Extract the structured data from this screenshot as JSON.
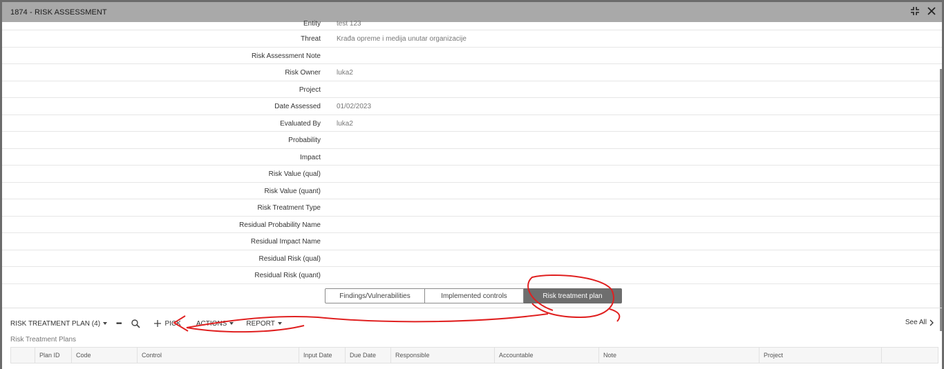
{
  "window": {
    "title": "1874 - RISK ASSESSMENT"
  },
  "fields": [
    {
      "label": "Entity",
      "value": "test 123"
    },
    {
      "label": "Threat",
      "value": "Krađa opreme i medija unutar organizacije"
    },
    {
      "label": "Risk Assessment Note",
      "value": ""
    },
    {
      "label": "Risk Owner",
      "value": "luka2"
    },
    {
      "label": "Project",
      "value": ""
    },
    {
      "label": "Date Assessed",
      "value": "01/02/2023"
    },
    {
      "label": "Evaluated By",
      "value": "luka2"
    },
    {
      "label": "Probability",
      "value": ""
    },
    {
      "label": "Impact",
      "value": ""
    },
    {
      "label": "Risk Value (qual)",
      "value": ""
    },
    {
      "label": "Risk Value (quant)",
      "value": ""
    },
    {
      "label": "Risk Treatment Type",
      "value": ""
    },
    {
      "label": "Residual Probability Name",
      "value": ""
    },
    {
      "label": "Residual Impact Name",
      "value": ""
    },
    {
      "label": "Residual Risk (qual)",
      "value": ""
    },
    {
      "label": "Residual Risk (quant)",
      "value": ""
    }
  ],
  "tabs": [
    {
      "label": "Findings/Vulnerabilities",
      "active": false
    },
    {
      "label": "Implemented controls",
      "active": false
    },
    {
      "label": "Risk treatment plan",
      "active": true
    }
  ],
  "toolbar": {
    "plan_label": "RISK TREATMENT PLAN (4)",
    "more_label": "•••",
    "pick_label": "PICK",
    "actions_label": "ACTIONS",
    "report_label": "REPORT",
    "see_all_label": "See All"
  },
  "section_title": "Risk Treatment Plans",
  "grid_columns": [
    "Plan ID",
    "Code",
    "Control",
    "Input Date",
    "Due Date",
    "Responsible",
    "Accountable",
    "Note",
    "Project",
    ""
  ],
  "colors": {
    "titlebar": "#a9a9a9",
    "active_tab": "#6e6e6e",
    "annotation": "#e02020"
  },
  "icons": [
    "collapse-icon",
    "close-icon",
    "search-icon",
    "plus-icon",
    "chevron-right-icon"
  ]
}
